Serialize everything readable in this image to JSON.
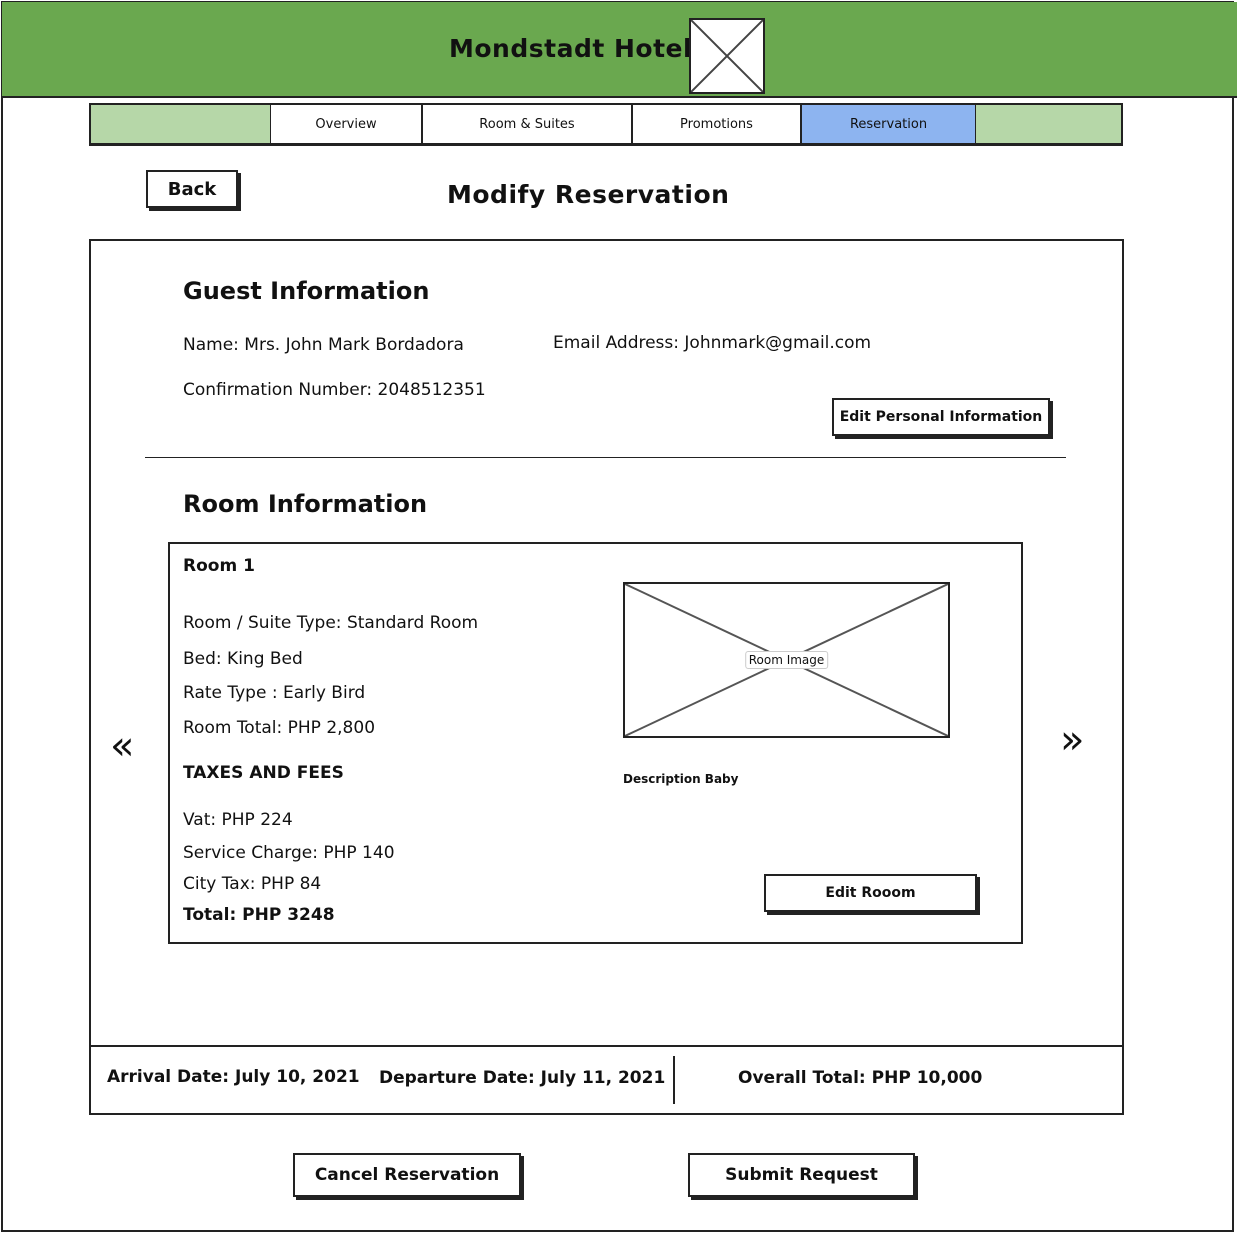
{
  "header": {
    "hotel_name": "Mondstadt Hotel"
  },
  "nav": {
    "tabs": [
      {
        "label": "Overview"
      },
      {
        "label": "Room & Suites"
      },
      {
        "label": "Promotions"
      },
      {
        "label": "Reservation"
      }
    ],
    "active": "Reservation",
    "active_color": "#8db4f0"
  },
  "page": {
    "back_label": "Back",
    "title": "Modify Reservation"
  },
  "guest": {
    "section_title": "Guest Information",
    "name": "Name: Mrs. John Mark Bordadora",
    "email": "Email Address: Johnmark@gmail.com",
    "confirmation": "Confirmation Number: 2048512351",
    "edit_label": "Edit Personal Information"
  },
  "room": {
    "section_title": "Room Information",
    "card_title": "Room 1",
    "suite_type": "Room / Suite Type: Standard Room",
    "bed": "Bed:  King Bed",
    "rate_type": "Rate Type : Early Bird",
    "room_total": "Room Total: PHP 2,800",
    "taxes_title": "TAXES AND FEES",
    "vat": "Vat: PHP 224",
    "service_charge": "Service Charge: PHP 140",
    "city_tax": "City Tax: PHP 84",
    "total": "Total: PHP 3248",
    "image_label": "Room Image",
    "description": "Description Baby",
    "edit_label": "Edit Rooom",
    "prev_icon": "«",
    "next_icon": "»"
  },
  "summary": {
    "arrival": "Arrival Date: July 10, 2021",
    "departure": "Departure Date: July 11, 2021",
    "overall_total": "Overall Total: PHP 10,000"
  },
  "actions": {
    "cancel_label": "Cancel Reservation",
    "submit_label": "Submit Request"
  },
  "colors": {
    "header_green": "#6aa84f",
    "nav_light_green": "#b6d7a8",
    "active_tab_blue": "#8db4f0"
  }
}
